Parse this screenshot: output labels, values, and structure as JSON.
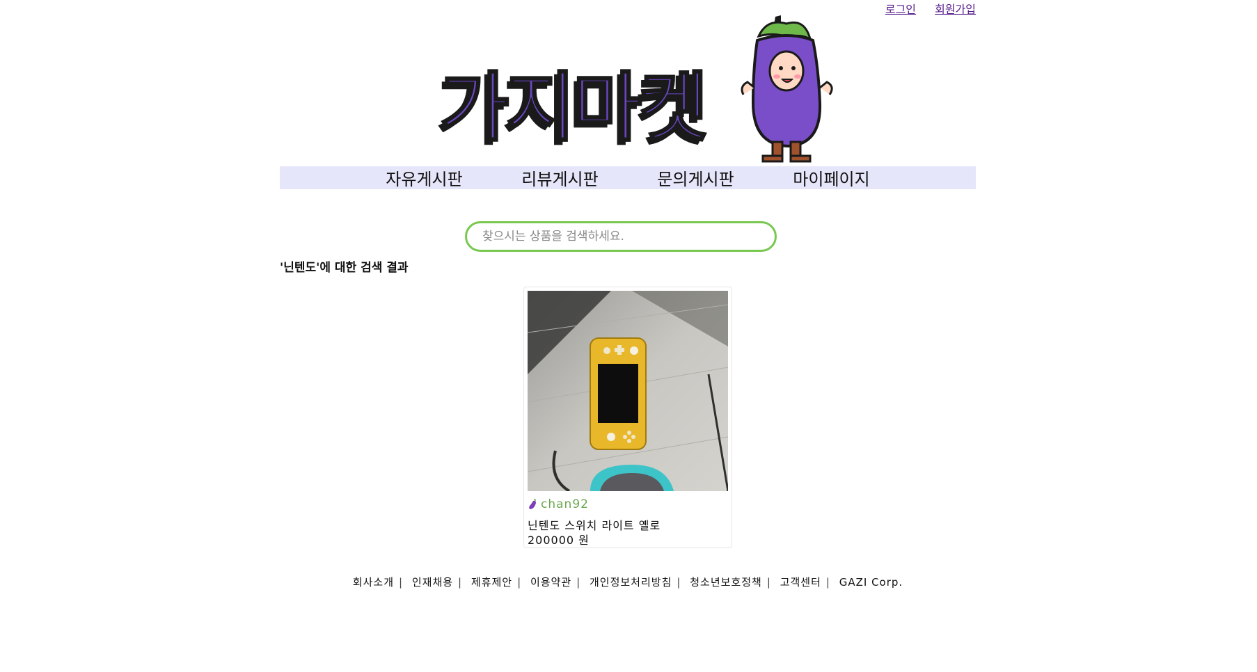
{
  "auth": {
    "login": "로그인",
    "signup": "회원가입"
  },
  "logo": {
    "text": "가지마켓"
  },
  "nav": [
    {
      "label": "자유게시판"
    },
    {
      "label": "리뷰게시판"
    },
    {
      "label": "문의게시판"
    },
    {
      "label": "마이페이지"
    }
  ],
  "search": {
    "placeholder": "찾으시는 상품을 검색하세요.",
    "value": ""
  },
  "results": {
    "title": "'닌텐도'에 대한 검색 결과"
  },
  "product": {
    "seller": "chan92",
    "name": "닌텐도 스위치 라이트 옐로",
    "price": "200000 원"
  },
  "footer": {
    "links": [
      "회사소개",
      "인재채용",
      "제휴제안",
      "이용약관",
      "개인정보처리방침",
      "청소년보호정책",
      "고객센터"
    ],
    "company": "GAZI Corp.",
    "separator": "|"
  },
  "colors": {
    "brand_purple": "#6a46c0",
    "nav_bg": "#e6e6fa",
    "search_border": "#78c850",
    "seller_green": "#6aa84f"
  },
  "icons": {
    "seller": "eggplant-icon",
    "mascot": "eggplant-mascot"
  }
}
